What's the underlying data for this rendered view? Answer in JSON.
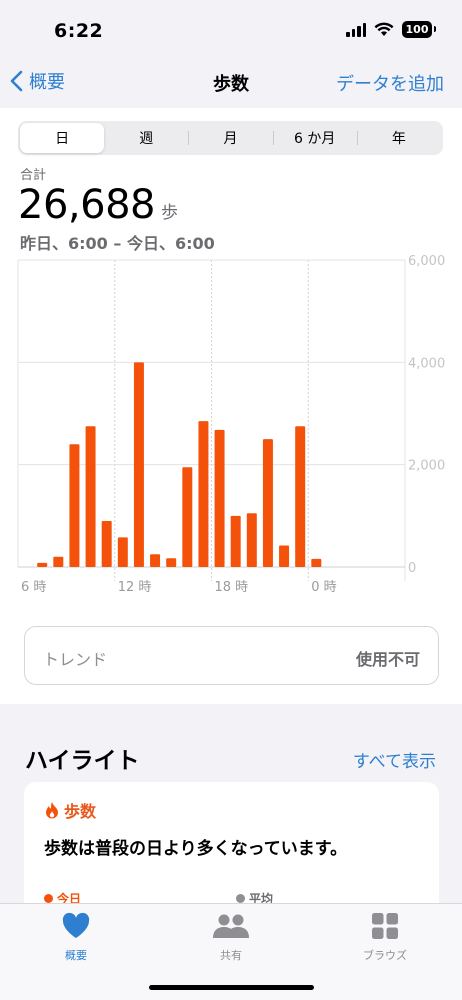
{
  "status_bar": {
    "time": "6:22",
    "battery": "100"
  },
  "nav": {
    "back_label": "概要",
    "title": "歩数",
    "action_label": "データを追加"
  },
  "segments": [
    {
      "label": "日",
      "active": true
    },
    {
      "label": "週",
      "active": false
    },
    {
      "label": "月",
      "active": false
    },
    {
      "label": "6 か月",
      "active": false
    },
    {
      "label": "年",
      "active": false
    }
  ],
  "summary": {
    "label": "合計",
    "value": "26,688",
    "unit": "歩",
    "range": "昨日、6:00 – 今日、6:00"
  },
  "chart_data": {
    "type": "bar",
    "categories": [
      "6",
      "7",
      "8",
      "9",
      "10",
      "11",
      "12",
      "13",
      "14",
      "15",
      "16",
      "17",
      "18",
      "19",
      "20",
      "21",
      "22",
      "23",
      "0",
      "1",
      "2",
      "3",
      "4",
      "5"
    ],
    "values": [
      0,
      80,
      200,
      2400,
      2750,
      900,
      580,
      4000,
      250,
      170,
      1950,
      2850,
      2680,
      1000,
      1050,
      2500,
      420,
      2750,
      160,
      0,
      0,
      0,
      0,
      0
    ],
    "x_tick_labels": [
      "6 時",
      "12 時",
      "18 時",
      "0 時"
    ],
    "y_tick_labels": [
      "0",
      "2,000",
      "4,000",
      "6,000"
    ],
    "ylim": [
      0,
      6000
    ],
    "bar_color": "#f4520a",
    "grid": true
  },
  "trend": {
    "label": "トレンド",
    "status": "使用不可"
  },
  "highlights": {
    "title": "ハイライト",
    "see_all": "すべて表示",
    "card_title": "歩数",
    "card_text": "歩数は普段の日より多くなっています。",
    "legend_today": "今日",
    "legend_avg": "平均"
  },
  "tabs": [
    {
      "label": "概要",
      "icon": "heart-icon",
      "active": true
    },
    {
      "label": "共有",
      "icon": "people-icon",
      "active": false
    },
    {
      "label": "ブラウズ",
      "icon": "grid-icon",
      "active": false
    }
  ],
  "colors": {
    "accent": "#2f7fd0",
    "steps": "#f4520a"
  }
}
